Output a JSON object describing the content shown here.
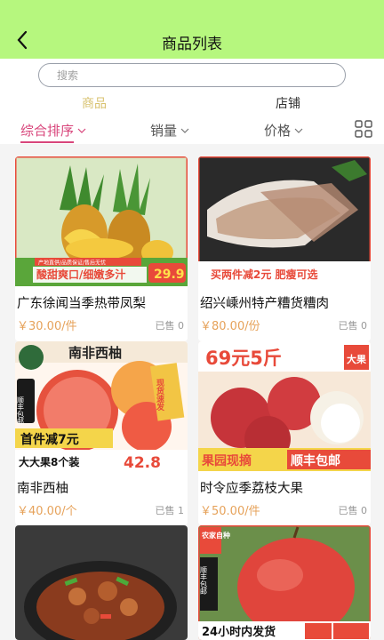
{
  "header": {
    "title": "商品列表"
  },
  "search": {
    "placeholder": "搜索"
  },
  "segments": {
    "goods": "商品",
    "shop": "店铺"
  },
  "sort": {
    "comprehensive": "综合排序",
    "sales": "销量",
    "price": "价格"
  },
  "colors": {
    "topbar": "#b6f77e",
    "active_sort": "#d8457b",
    "active_segment": "#d8c26f",
    "price": "#e6a25a"
  },
  "products": [
    {
      "name": "广东徐闻当季热带凤梨",
      "price": "￥30.00/件",
      "sold": "已售 0",
      "badges": {
        "price_tag": "29.9",
        "slogan": "酸甜爽口/细嫩多汁",
        "small": "产地直供/品质保证/售后无忧"
      }
    },
    {
      "name": "绍兴嵊州特产糟货糟肉",
      "price": "￥80.00/份",
      "sold": "已售 0",
      "badges": {
        "promo": "买两件减2元  肥瘦可选"
      }
    },
    {
      "name": "南非西柚",
      "price": "￥40.00/个",
      "sold": "已售 1",
      "badges": {
        "title": "南非西柚",
        "sf": "顺丰包邮",
        "fresh": "现货速发",
        "discount": "首件减7元",
        "bundle": "大大果8个装",
        "bundle_price": "42.8"
      }
    },
    {
      "name": "时令应季荔枝大果",
      "price": "￥50.00/件",
      "sold": "已售 0",
      "badges": {
        "headline": "69元5斤",
        "big": "大果",
        "orchard": "果园现摘",
        "sf": "顺丰包邮"
      }
    },
    {
      "name": "",
      "price": "",
      "sold": "",
      "badges": {}
    },
    {
      "name": "",
      "price": "",
      "sold": "",
      "badges": {
        "farm": "农家自种",
        "sf": "顺丰包邮",
        "ship": "24小时内发货"
      }
    }
  ]
}
